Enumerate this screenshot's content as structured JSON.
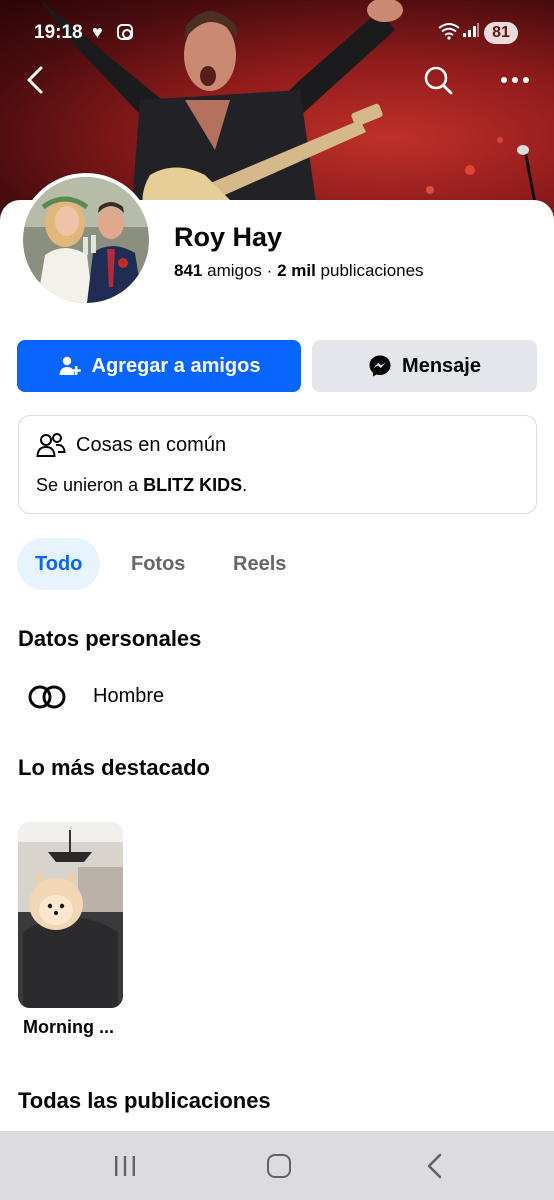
{
  "status": {
    "time": "19:18",
    "battery": "81",
    "heart_icon": "heart-icon",
    "instagram_icon": "instagram-icon"
  },
  "nav": {
    "back_icon": "back-arrow-icon",
    "search_icon": "search-icon",
    "more_icon": "more-icon"
  },
  "profile": {
    "name": "Roy Hay",
    "friends_count": "841",
    "friends_label": "amigos",
    "separator": "·",
    "posts_count": "2 mil",
    "posts_label": "publicaciones"
  },
  "actions": {
    "add_friend": "Agregar a amigos",
    "message": "Mensaje"
  },
  "common": {
    "title": "Cosas en común",
    "text_prefix": "Se unieron a ",
    "group": "BLITZ KIDS",
    "text_suffix": "."
  },
  "tabs": [
    {
      "label": "Todo",
      "active": true
    },
    {
      "label": "Fotos",
      "active": false
    },
    {
      "label": "Reels",
      "active": false
    }
  ],
  "sections": {
    "personal": "Datos personales",
    "gender": "Hombre",
    "highlights": "Lo más destacado",
    "highlight_label": "Morning ...",
    "all_posts": "Todas las publicaciones"
  },
  "colors": {
    "accent": "#0866ff",
    "tab_active_bg": "#e7f3ff",
    "secondary_button": "#e4e6eb"
  }
}
